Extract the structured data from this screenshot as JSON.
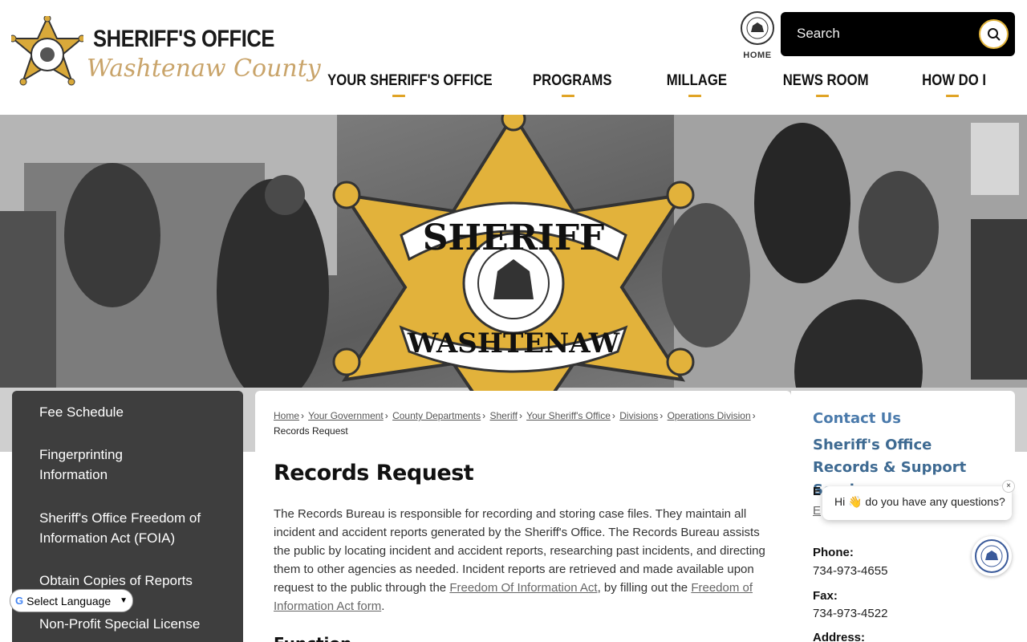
{
  "logo": {
    "title": "SHERIFF'S OFFICE",
    "subtitle": "Washtenaw County"
  },
  "home": {
    "label": "HOME"
  },
  "search": {
    "placeholder": "Search"
  },
  "nav": [
    {
      "label": "YOUR SHERIFF'S OFFICE"
    },
    {
      "label": "PROGRAMS"
    },
    {
      "label": "MILLAGE"
    },
    {
      "label": "NEWS ROOM"
    },
    {
      "label": "HOW DO I"
    }
  ],
  "hero": {
    "badge_top": "SHERIFF",
    "badge_bottom": "WASHTENAW"
  },
  "sidebar": {
    "items": [
      {
        "label": "Fee Schedule"
      },
      {
        "label": "Fingerprinting Information"
      },
      {
        "label": "Sheriff's Office Freedom of Information Act (FOIA)"
      },
      {
        "label": "Obtain Copies of Reports"
      },
      {
        "label": "Non-Profit Special License"
      }
    ]
  },
  "language": {
    "label": "Select Language"
  },
  "breadcrumb": {
    "items": [
      "Home",
      "Your Government",
      "County Departments",
      "Sheriff",
      "Your Sheriff's Office",
      "Divisions",
      "Operations Division"
    ],
    "current": "Records Request"
  },
  "content": {
    "title": "Records Request",
    "para_start": "The Records Bureau is responsible for recording and storing case files. They maintain all incident and accident reports generated by the Sheriff's Office. The Records Bureau assists the public by locating incident and accident reports, researching past incidents, and directing them to other agencies as needed. Incident reports are retrieved and made available upon request to the public through the ",
    "link1": "Freedom Of Information Act",
    "para_mid": ", by filling out the ",
    "link2": "Freedom of Information Act form",
    "para_end": ".",
    "next_heading": "Function"
  },
  "contact": {
    "heading": "Contact Us",
    "department": "Sheriff's Office Records & Support Services",
    "email_label": "E",
    "email_link": "E",
    "phone_label": "Phone:",
    "phone": "734-973-4655",
    "fax_label": "Fax:",
    "fax": "734-973-4522",
    "address_label": "Address:"
  },
  "chat": {
    "message": "Hi 👋 do you have any questions?",
    "close": "×"
  },
  "colors": {
    "accent_gold": "#e0a426",
    "link_blue": "#4a7aab",
    "sidebar_bg": "#3e3e3e"
  }
}
